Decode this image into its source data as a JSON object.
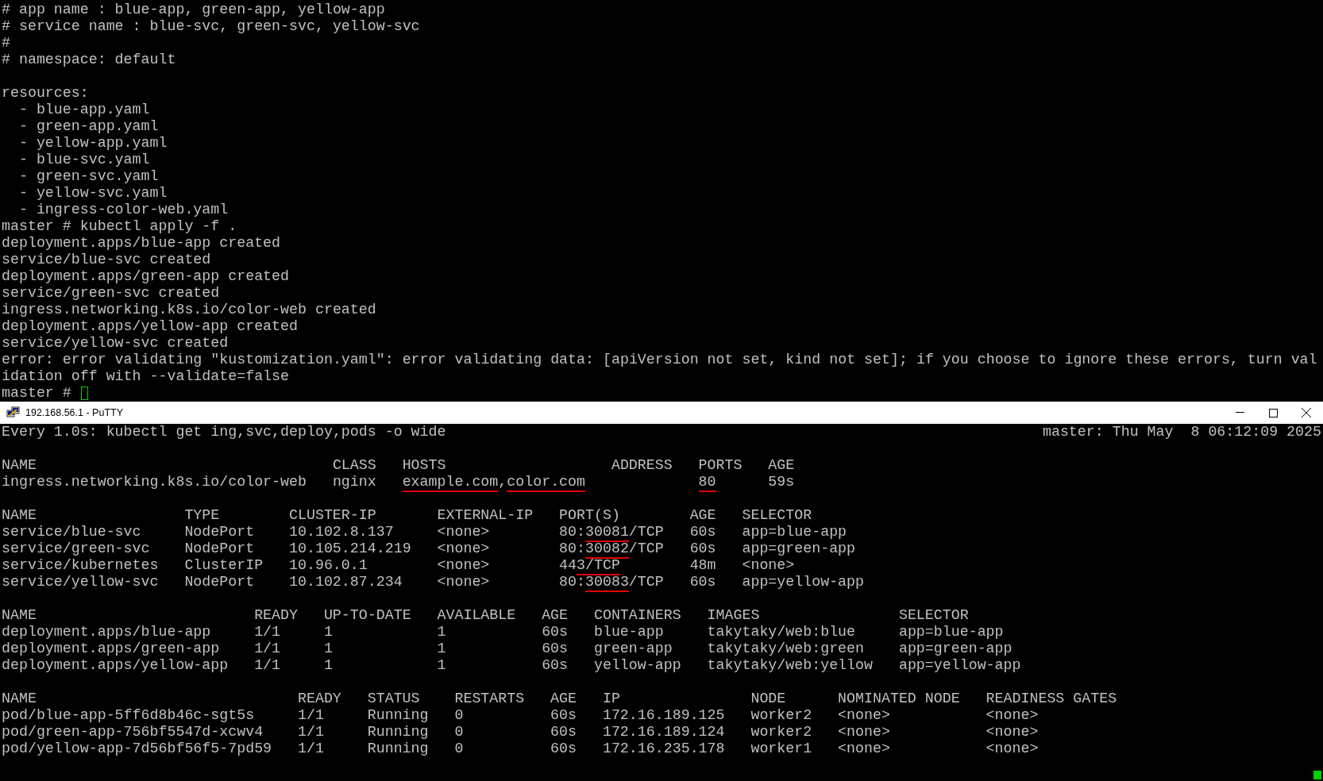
{
  "upper_terminal": {
    "blocks": [
      [
        "# app name : blue-app, green-app, yellow-app",
        "# service name : blue-svc, green-svc, yellow-svc",
        "#",
        "# namespace: default"
      ],
      [
        "resources:",
        "  - blue-app.yaml",
        "  - green-app.yaml",
        "  - yellow-app.yaml",
        "  - blue-svc.yaml",
        "  - green-svc.yaml",
        "  - yellow-svc.yaml",
        "  - ingress-color-web.yaml",
        "master # kubectl apply -f .",
        "deployment.apps/blue-app created",
        "service/blue-svc created",
        "deployment.apps/green-app created",
        "service/green-svc created",
        "ingress.networking.k8s.io/color-web created",
        "deployment.apps/yellow-app created",
        "service/yellow-svc created",
        "error: error validating \"kustomization.yaml\": error validating data: [apiVersion not set, kind not set]; if you choose to ignore these errors, turn val",
        "idation off with --validate=false",
        "master # "
      ]
    ],
    "cursor_visible": true
  },
  "putty_window": {
    "title": "192.168.56.1 - PuTTY"
  },
  "watch_terminal": {
    "command": "Every 1.0s: kubectl get ing,svc,deploy,pods -o wide",
    "status": "master: Thu May  8 06:12:09 2025",
    "tables": [
      {
        "columns": [
          "NAME",
          "CLASS",
          "HOSTS",
          "ADDRESS",
          "PORTS",
          "AGE"
        ],
        "rows": [
          [
            "ingress.networking.k8s.io/color-web",
            "nginx",
            [
              {
                "text": "example.com",
                "underlined": true
              },
              {
                "text": ",",
                "underlined": false
              },
              {
                "text": "color.com",
                "underlined": true
              }
            ],
            "",
            [
              {
                "text": "80",
                "underlined": true
              }
            ],
            "59s"
          ]
        ]
      },
      {
        "columns": [
          "NAME",
          "TYPE",
          "CLUSTER-IP",
          "EXTERNAL-IP",
          "PORT(S)",
          "AGE",
          "SELECTOR"
        ],
        "rows": [
          [
            "service/blue-svc",
            "NodePort",
            "10.102.8.137",
            "<none>",
            [
              {
                "text": "80:",
                "underlined": false
              },
              {
                "text": "30081",
                "underlined": true
              },
              {
                "text": "/TCP",
                "underlined": false
              }
            ],
            "60s",
            "app=blue-app"
          ],
          [
            "service/green-svc",
            "NodePort",
            "10.105.214.219",
            "<none>",
            [
              {
                "text": "80:",
                "underlined": false
              },
              {
                "text": "30082",
                "underlined": true
              },
              {
                "text": "/TCP",
                "underlined": false
              }
            ],
            "60s",
            "app=green-app"
          ],
          [
            "service/kubernetes",
            "ClusterIP",
            "10.96.0.1",
            "<none>",
            [
              {
                "text": "44",
                "underlined": false
              },
              {
                "text": "3/TCP",
                "underlined": true
              }
            ],
            "48m",
            "<none>"
          ],
          [
            "service/yellow-svc",
            "NodePort",
            "10.102.87.234",
            "<none>",
            [
              {
                "text": "80:",
                "underlined": false
              },
              {
                "text": "30083",
                "underlined": true
              },
              {
                "text": "/TCP",
                "underlined": false
              }
            ],
            "60s",
            "app=yellow-app"
          ]
        ]
      },
      {
        "columns": [
          "NAME",
          "READY",
          "UP-TO-DATE",
          "AVAILABLE",
          "AGE",
          "CONTAINERS",
          "IMAGES",
          "SELECTOR"
        ],
        "rows": [
          [
            "deployment.apps/blue-app",
            "1/1",
            "1",
            "1",
            "60s",
            "blue-app",
            "takytaky/web:blue",
            "app=blue-app"
          ],
          [
            "deployment.apps/green-app",
            "1/1",
            "1",
            "1",
            "60s",
            "green-app",
            "takytaky/web:green",
            "app=green-app"
          ],
          [
            "deployment.apps/yellow-app",
            "1/1",
            "1",
            "1",
            "60s",
            "yellow-app",
            "takytaky/web:yellow",
            "app=yellow-app"
          ]
        ]
      },
      {
        "columns": [
          "NAME",
          "READY",
          "STATUS",
          "RESTARTS",
          "AGE",
          "IP",
          "NODE",
          "NOMINATED NODE",
          "READINESS GATES"
        ],
        "rows": [
          [
            "pod/blue-app-5ff6d8b46c-sgt5s",
            "1/1",
            "Running",
            "0",
            "60s",
            "172.16.189.125",
            "worker2",
            "<none>",
            "<none>"
          ],
          [
            "pod/green-app-756bf5547d-xcwv4",
            "1/1",
            "Running",
            "0",
            "60s",
            "172.16.189.124",
            "worker2",
            "<none>",
            "<none>"
          ],
          [
            "pod/yellow-app-7d56bf56f5-7pd59",
            "1/1",
            "Running",
            "0",
            "60s",
            "172.16.235.178",
            "worker1",
            "<none>",
            "<none>"
          ]
        ]
      }
    ],
    "cursor_visible": true
  }
}
